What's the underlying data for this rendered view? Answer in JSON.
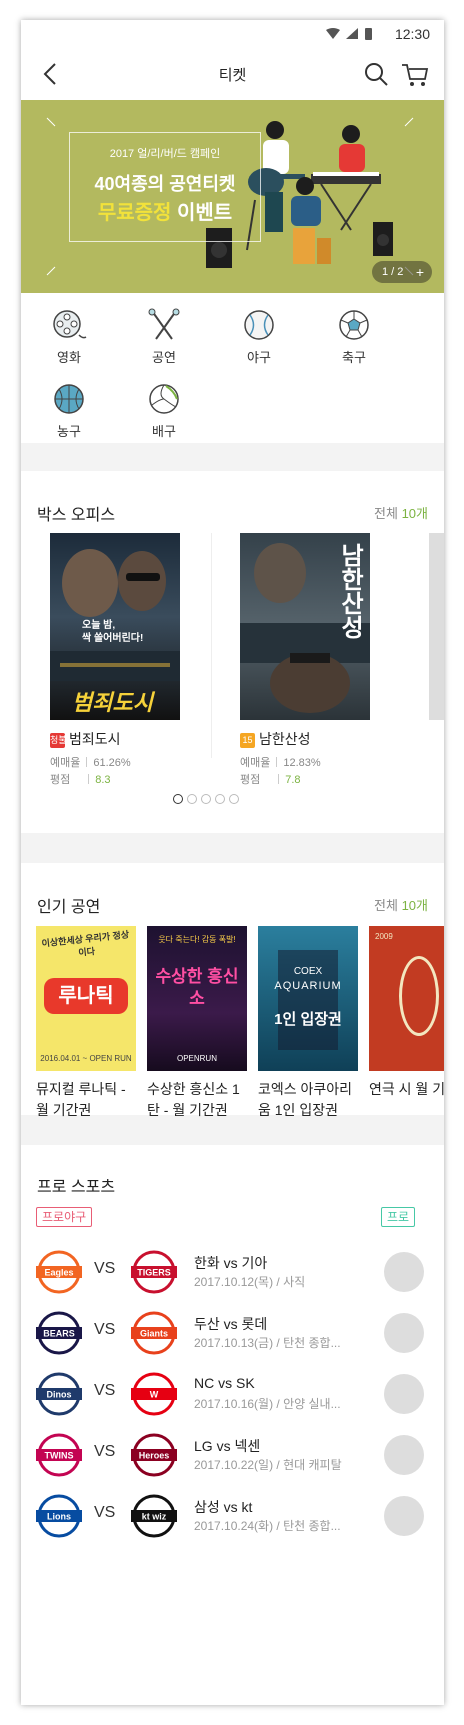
{
  "status": {
    "time": "12:30"
  },
  "header": {
    "title": "티켓"
  },
  "banner": {
    "subtitle": "2017 얼/리/버/드 캠페인",
    "line1": "40여종의 공연티켓",
    "line2_highlight": "무료증정",
    "line2_rest": " 이벤트",
    "pager": "1 / 2",
    "pager_plus": "+"
  },
  "categories": [
    {
      "label": "영화",
      "icon": "film-reel-icon"
    },
    {
      "label": "공연",
      "icon": "drumsticks-icon"
    },
    {
      "label": "야구",
      "icon": "baseball-icon"
    },
    {
      "label": "축구",
      "icon": "soccer-ball-icon"
    },
    {
      "label": "농구",
      "icon": "basketball-icon"
    },
    {
      "label": "배구",
      "icon": "volleyball-icon"
    }
  ],
  "boxoffice": {
    "title": "박스 오피스",
    "all_label": "전체 ",
    "all_count": "10개",
    "movies": [
      {
        "rating": "청불",
        "rating_color": "#e53935",
        "name": "범죄도시",
        "presale_label": "예매율",
        "presale": "61.26%",
        "score_label": "평점",
        "score": "8.3",
        "poster_lines": [
          "오늘 밤,",
          "싹 쓸어버린다!"
        ],
        "poster_title": "범죄도시"
      },
      {
        "rating": "15",
        "rating_color": "#f5a623",
        "name": "남한산성",
        "presale_label": "예매율",
        "presale": "12.83%",
        "score_label": "평점",
        "score": "7.8",
        "poster_title": "남한산성"
      }
    ],
    "pages": 5
  },
  "shows": {
    "title": "인기 공연",
    "all_label": "전체 ",
    "all_count": "10개",
    "items": [
      {
        "name": "뮤지컬 루나틱 - 월 기간권",
        "poster_title": "루나틱",
        "poster_top": "이상한세상 우리가 정상이다",
        "poster_bottom": "2016.04.01 ~ OPEN RUN"
      },
      {
        "name": "수상한 흥신소 1탄 - 월 기간권",
        "poster_title": "수상한 흥신소",
        "poster_top": "웃다 죽는다! 감동 폭발!",
        "poster_bottom": "OPENRUN"
      },
      {
        "name": "코엑스 아쿠아리움 1인 입장권",
        "poster_brand": "COEX",
        "poster_title": "AQUARIUM",
        "poster_sub": "1인 입장권"
      },
      {
        "name": "연극 시 월 기간",
        "poster_top": "2009"
      }
    ]
  },
  "sports": {
    "title": "프로 스포츠",
    "badge1": "프로야구",
    "badge2": "프로",
    "matches": [
      {
        "name": "한화 vs 기아",
        "date": "2017.10.12(목) / 사직",
        "home": "Eagles",
        "away": "TIGERS",
        "home_color": "#f26522",
        "away_color": "#c8102e"
      },
      {
        "name": "두산 vs 롯데",
        "date": "2017.10.13(금) / 탄천 종합...",
        "home": "BEARS",
        "away": "Giants",
        "home_color": "#1a1748",
        "away_color": "#e8411c"
      },
      {
        "name": "NC vs SK",
        "date": "2017.10.16(월) / 안양 실내...",
        "home": "Dinos",
        "away": "W",
        "home_color": "#1f3a6b",
        "away_color": "#e60012"
      },
      {
        "name": "LG vs 넥센",
        "date": "2017.10.22(일) / 현대 캐피탈",
        "home": "TWINS",
        "away": "Heroes",
        "home_color": "#c30452",
        "away_color": "#8b0021"
      },
      {
        "name": "삼성 vs kt",
        "date": "2017.10.24(화) / 탄천 종합...",
        "home": "Lions",
        "away": "kt wiz",
        "home_color": "#074ca1",
        "away_color": "#111111"
      }
    ],
    "vs_label": "VS"
  }
}
